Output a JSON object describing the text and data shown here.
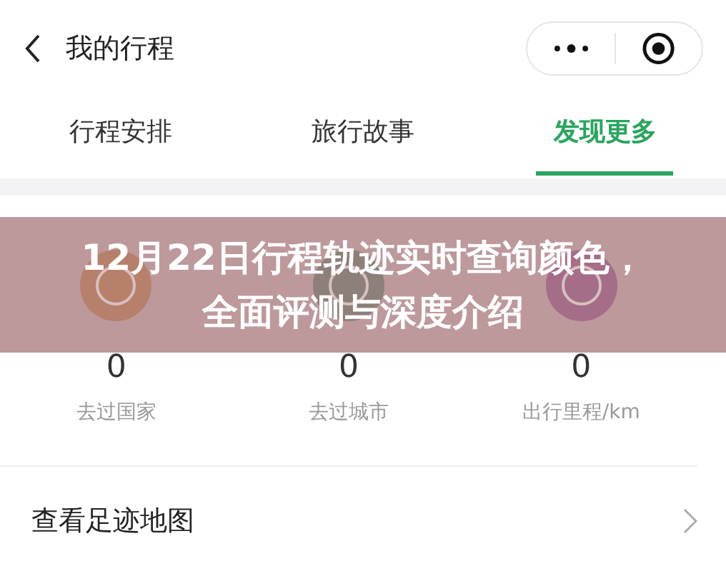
{
  "header": {
    "title": "我的行程"
  },
  "tabs": [
    {
      "label": "行程安排",
      "selected": false
    },
    {
      "label": "旅行故事",
      "selected": false
    },
    {
      "label": "发现更多",
      "selected": true
    }
  ],
  "stats": [
    {
      "value": "0",
      "label": "去过国家",
      "color": "#b7806b"
    },
    {
      "value": "0",
      "label": "去过城市",
      "color": "#8d8079"
    },
    {
      "value": "0",
      "label": "出行里程/km",
      "color": "#a46d88"
    }
  ],
  "list": [
    {
      "label": "查看足迹地图"
    }
  ],
  "banner": {
    "title": "12月22日行程轨迹实时查询颜色，全面评测与深度介绍"
  }
}
